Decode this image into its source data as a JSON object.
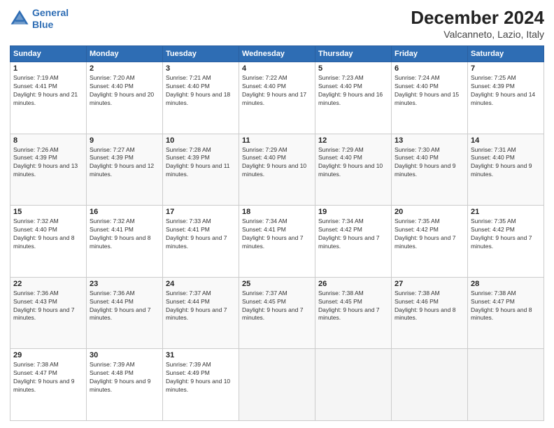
{
  "header": {
    "logo_line1": "General",
    "logo_line2": "Blue",
    "title": "December 2024",
    "subtitle": "Valcanneto, Lazio, Italy"
  },
  "calendar": {
    "days_of_week": [
      "Sunday",
      "Monday",
      "Tuesday",
      "Wednesday",
      "Thursday",
      "Friday",
      "Saturday"
    ],
    "weeks": [
      [
        {
          "day": "1",
          "rise": "7:19 AM",
          "set": "4:41 PM",
          "daylight": "9 hours and 21 minutes."
        },
        {
          "day": "2",
          "rise": "7:20 AM",
          "set": "4:40 PM",
          "daylight": "9 hours and 20 minutes."
        },
        {
          "day": "3",
          "rise": "7:21 AM",
          "set": "4:40 PM",
          "daylight": "9 hours and 18 minutes."
        },
        {
          "day": "4",
          "rise": "7:22 AM",
          "set": "4:40 PM",
          "daylight": "9 hours and 17 minutes."
        },
        {
          "day": "5",
          "rise": "7:23 AM",
          "set": "4:40 PM",
          "daylight": "9 hours and 16 minutes."
        },
        {
          "day": "6",
          "rise": "7:24 AM",
          "set": "4:40 PM",
          "daylight": "9 hours and 15 minutes."
        },
        {
          "day": "7",
          "rise": "7:25 AM",
          "set": "4:39 PM",
          "daylight": "9 hours and 14 minutes."
        }
      ],
      [
        {
          "day": "8",
          "rise": "7:26 AM",
          "set": "4:39 PM",
          "daylight": "9 hours and 13 minutes."
        },
        {
          "day": "9",
          "rise": "7:27 AM",
          "set": "4:39 PM",
          "daylight": "9 hours and 12 minutes."
        },
        {
          "day": "10",
          "rise": "7:28 AM",
          "set": "4:39 PM",
          "daylight": "9 hours and 11 minutes."
        },
        {
          "day": "11",
          "rise": "7:29 AM",
          "set": "4:40 PM",
          "daylight": "9 hours and 10 minutes."
        },
        {
          "day": "12",
          "rise": "7:29 AM",
          "set": "4:40 PM",
          "daylight": "9 hours and 10 minutes."
        },
        {
          "day": "13",
          "rise": "7:30 AM",
          "set": "4:40 PM",
          "daylight": "9 hours and 9 minutes."
        },
        {
          "day": "14",
          "rise": "7:31 AM",
          "set": "4:40 PM",
          "daylight": "9 hours and 9 minutes."
        }
      ],
      [
        {
          "day": "15",
          "rise": "7:32 AM",
          "set": "4:40 PM",
          "daylight": "9 hours and 8 minutes."
        },
        {
          "day": "16",
          "rise": "7:32 AM",
          "set": "4:41 PM",
          "daylight": "9 hours and 8 minutes."
        },
        {
          "day": "17",
          "rise": "7:33 AM",
          "set": "4:41 PM",
          "daylight": "9 hours and 7 minutes."
        },
        {
          "day": "18",
          "rise": "7:34 AM",
          "set": "4:41 PM",
          "daylight": "9 hours and 7 minutes."
        },
        {
          "day": "19",
          "rise": "7:34 AM",
          "set": "4:42 PM",
          "daylight": "9 hours and 7 minutes."
        },
        {
          "day": "20",
          "rise": "7:35 AM",
          "set": "4:42 PM",
          "daylight": "9 hours and 7 minutes."
        },
        {
          "day": "21",
          "rise": "7:35 AM",
          "set": "4:42 PM",
          "daylight": "9 hours and 7 minutes."
        }
      ],
      [
        {
          "day": "22",
          "rise": "7:36 AM",
          "set": "4:43 PM",
          "daylight": "9 hours and 7 minutes."
        },
        {
          "day": "23",
          "rise": "7:36 AM",
          "set": "4:44 PM",
          "daylight": "9 hours and 7 minutes."
        },
        {
          "day": "24",
          "rise": "7:37 AM",
          "set": "4:44 PM",
          "daylight": "9 hours and 7 minutes."
        },
        {
          "day": "25",
          "rise": "7:37 AM",
          "set": "4:45 PM",
          "daylight": "9 hours and 7 minutes."
        },
        {
          "day": "26",
          "rise": "7:38 AM",
          "set": "4:45 PM",
          "daylight": "9 hours and 7 minutes."
        },
        {
          "day": "27",
          "rise": "7:38 AM",
          "set": "4:46 PM",
          "daylight": "9 hours and 8 minutes."
        },
        {
          "day": "28",
          "rise": "7:38 AM",
          "set": "4:47 PM",
          "daylight": "9 hours and 8 minutes."
        }
      ],
      [
        {
          "day": "29",
          "rise": "7:38 AM",
          "set": "4:47 PM",
          "daylight": "9 hours and 9 minutes."
        },
        {
          "day": "30",
          "rise": "7:39 AM",
          "set": "4:48 PM",
          "daylight": "9 hours and 9 minutes."
        },
        {
          "day": "31",
          "rise": "7:39 AM",
          "set": "4:49 PM",
          "daylight": "9 hours and 10 minutes."
        },
        null,
        null,
        null,
        null
      ]
    ],
    "labels": {
      "sunrise": "Sunrise:",
      "sunset": "Sunset:",
      "daylight": "Daylight:"
    }
  }
}
